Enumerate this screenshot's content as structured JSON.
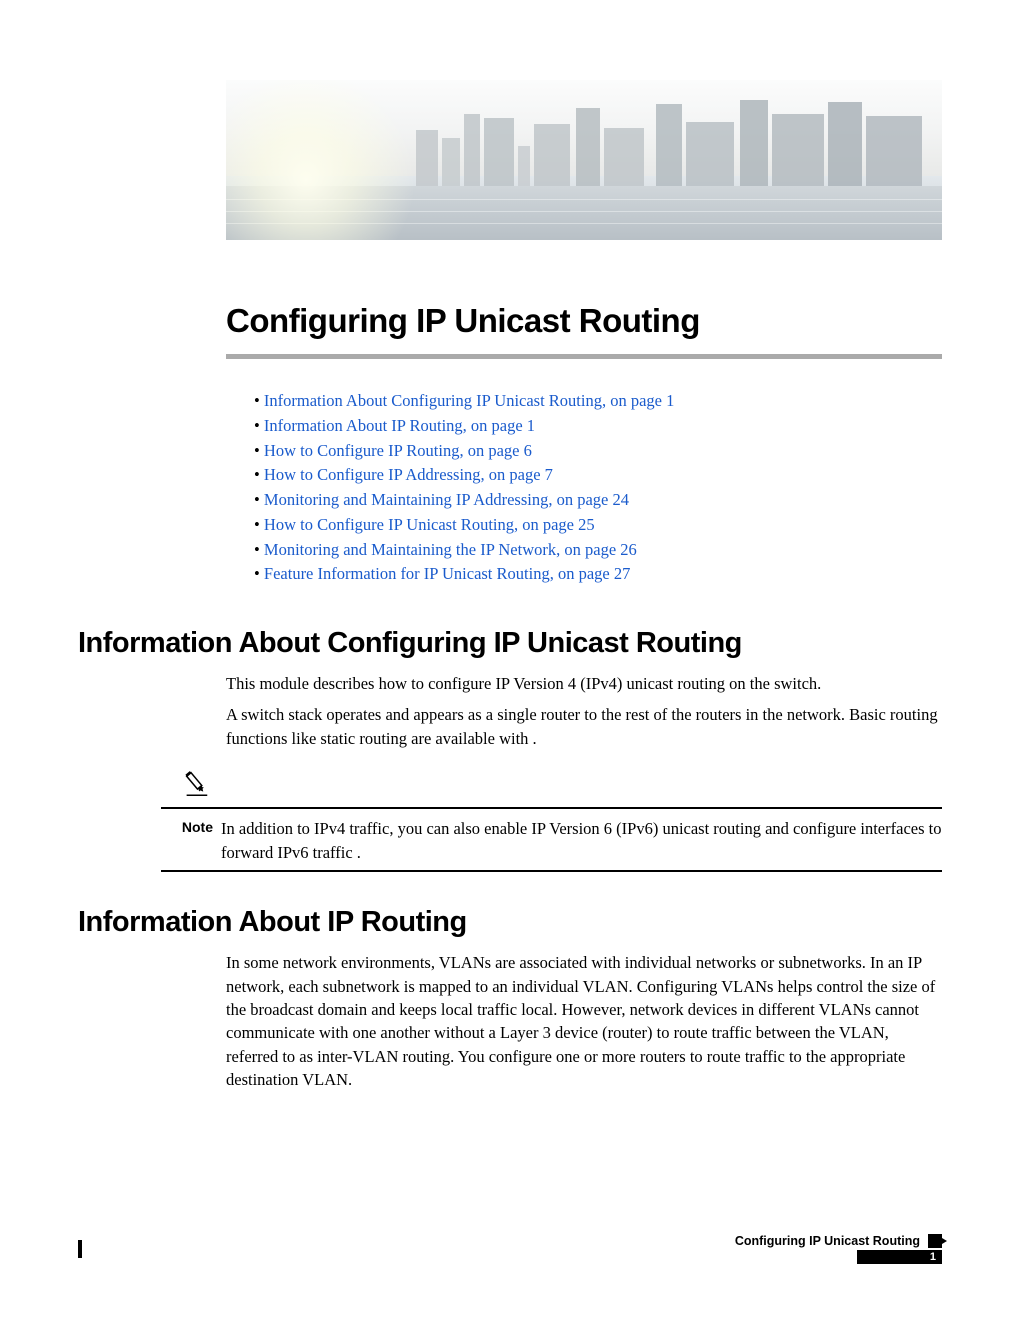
{
  "chapter": {
    "title": "Configuring IP Unicast Routing"
  },
  "toc": [
    "Information About Configuring IP Unicast Routing, on page 1",
    "Information About IP Routing, on page 1",
    "How to Configure IP Routing, on page 6",
    "How to Configure IP Addressing, on page 7",
    "Monitoring and Maintaining IP Addressing, on page 24",
    "How to Configure IP Unicast Routing, on page 25",
    "Monitoring and Maintaining the IP Network, on page 26",
    "Feature Information for IP Unicast Routing, on page 27"
  ],
  "sections": {
    "s1": {
      "heading": "Information About Configuring IP Unicast Routing",
      "p1": "This module describes how to configure IP Version 4 (IPv4) unicast routing on the switch.",
      "p2": "A switch stack operates and appears as a single router to the rest of the routers in the network. Basic routing functions like static routing are available with  ."
    },
    "note": {
      "label": "Note",
      "text": "In addition to IPv4 traffic, you can also enable IP Version 6 (IPv6) unicast routing and configure interfaces to forward IPv6 traffic ."
    },
    "s2": {
      "heading": "Information About IP Routing",
      "p1": "In some network environments, VLANs are associated with individual networks or subnetworks. In an IP network, each subnetwork is mapped to an individual VLAN. Configuring VLANs helps control the size of the broadcast domain and keeps local traffic local. However, network devices in different VLANs cannot communicate with one another without a Layer 3 device (router) to route traffic between the VLAN, referred to as inter-VLAN routing. You configure one or more routers to route traffic to the appropriate destination VLAN."
    }
  },
  "footer": {
    "title": "Configuring IP Unicast Routing",
    "page": "1"
  }
}
